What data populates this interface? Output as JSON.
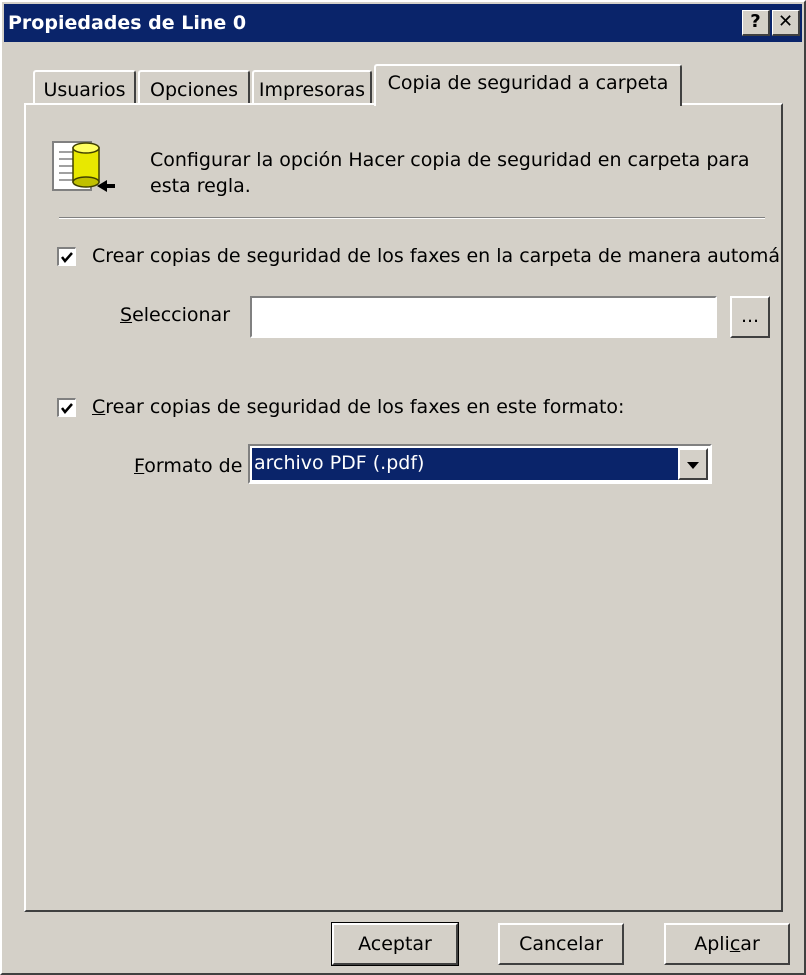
{
  "window": {
    "title": "Propiedades de Line 0",
    "help_label": "?",
    "close_label": "✕"
  },
  "tabs": [
    {
      "label": "Usuarios"
    },
    {
      "label": "Opciones"
    },
    {
      "label": "Impresoras"
    },
    {
      "label": "Copia de seguridad a carpeta",
      "active": true
    }
  ],
  "panel": {
    "icon": "backup-folder-icon",
    "description": "Configurar la opción Hacer copia de seguridad en carpeta para esta regla.",
    "auto_backup": {
      "label": "Crear copias de seguridad de los faxes en la carpeta de manera automá",
      "checked": true
    },
    "select": {
      "label_accel": "S",
      "label_rest": "eleccionar",
      "value": "",
      "browse_label": "..."
    },
    "format_backup": {
      "label_accel": "C",
      "label_rest": "rear copias de seguridad de los faxes en este formato:",
      "checked": true
    },
    "format": {
      "label_accel": "F",
      "label_rest": "ormato de",
      "selected": "archivo PDF (.pdf)"
    }
  },
  "buttons": {
    "ok": "Aceptar",
    "cancel": "Cancelar",
    "apply_pre": "Apli",
    "apply_accel": "c",
    "apply_post": "ar"
  }
}
